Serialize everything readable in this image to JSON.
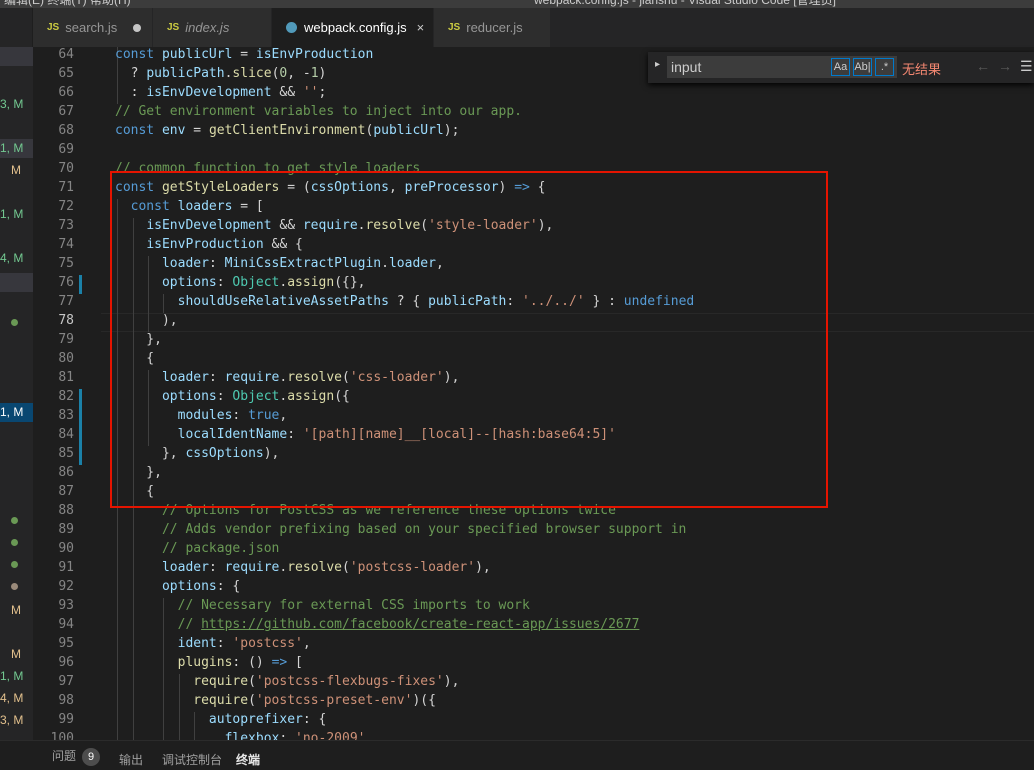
{
  "window": {
    "menu": "编辑(E)    终端(T)    帮助(H)",
    "title": "webpack.config.js - jianshu - Visual Studio Code [管理员]"
  },
  "tabs": [
    {
      "icon": "JS",
      "label": "search.js",
      "modified": true
    },
    {
      "icon": "JS",
      "label": "index.js",
      "italic": true
    },
    {
      "icon": "gear",
      "label": "webpack.config.js",
      "active": true,
      "close": "×"
    },
    {
      "icon": "JS",
      "label": "reducer.js"
    }
  ],
  "sidebar": {
    "badges": [
      "3, M",
      "1, M",
      "M",
      "1, M",
      "4, M",
      "1, M",
      "M",
      "M",
      "1, M",
      "4, M",
      "3, M"
    ]
  },
  "find": {
    "toggle": "▸",
    "value": "input",
    "opt_case": "Aa",
    "opt_word": "Ab|",
    "opt_regex": ".*",
    "result": "无结果",
    "prev": "←",
    "next": "→",
    "sel": "☰"
  },
  "editor": {
    "line_numbers": [
      "64",
      "65",
      "66",
      "67",
      "68",
      "69",
      "70",
      "71",
      "72",
      "73",
      "74",
      "75",
      "76",
      "77",
      "78",
      "79",
      "80",
      "81",
      "82",
      "83",
      "84",
      "85",
      "86",
      "87",
      "88",
      "89",
      "90",
      "91",
      "92",
      "93",
      "94",
      "95",
      "96",
      "97",
      "98",
      "99",
      "100"
    ],
    "current_line": "78"
  },
  "panel": {
    "problems": "问题",
    "problems_count": "9",
    "output": "输出",
    "debug_console": "调试控制台",
    "terminal": "终端"
  },
  "colors": {
    "accent": "#007acc",
    "highlight_box": "#e51400",
    "keyword": "#569cd6",
    "string": "#ce9178",
    "comment": "#6a9955"
  }
}
